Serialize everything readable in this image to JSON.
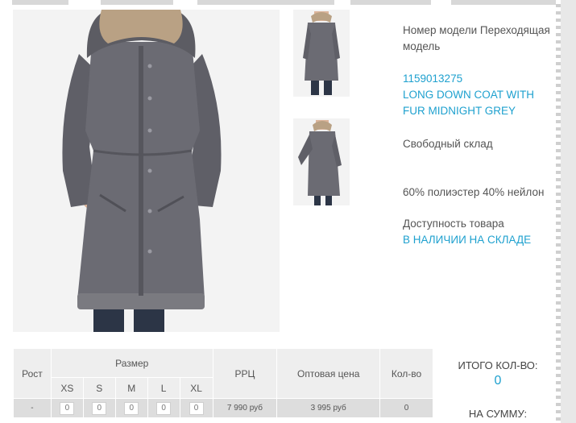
{
  "product": {
    "model_label": "Номер модели Переходящая модель",
    "article": "1159013275",
    "name": "LONG DOWN COAT WITH FUR MIDNIGHT GREY",
    "fit": "Свободный склад",
    "composition": "60% полиэстер 40% нейлон",
    "availability_label": "Доступность товара",
    "availability_value": "В НАЛИЧИИ НА СКЛАДЕ"
  },
  "table": {
    "col_height": "Рост",
    "col_size": "Размер",
    "sizes": [
      "XS",
      "S",
      "M",
      "L",
      "XL"
    ],
    "col_rrp": "РРЦ",
    "col_wholesale": "Оптовая цена",
    "col_qty": "Кол-во",
    "row": {
      "height": "-",
      "size_qty": [
        "0",
        "0",
        "0",
        "0",
        "0"
      ],
      "rrp": "7 990 руб",
      "wholesale": "3 995 руб",
      "qty": "0"
    }
  },
  "summary": {
    "total_qty_label": "ИТОГО КОЛ-ВО:",
    "total_qty_value": "0",
    "sum_label": "НА СУММУ:"
  },
  "colors": {
    "link": "#1fa1cf",
    "coat": "#6b6b73",
    "fur": "#b9a184",
    "jeans": "#2c3546",
    "skin": "#dcb59b"
  }
}
